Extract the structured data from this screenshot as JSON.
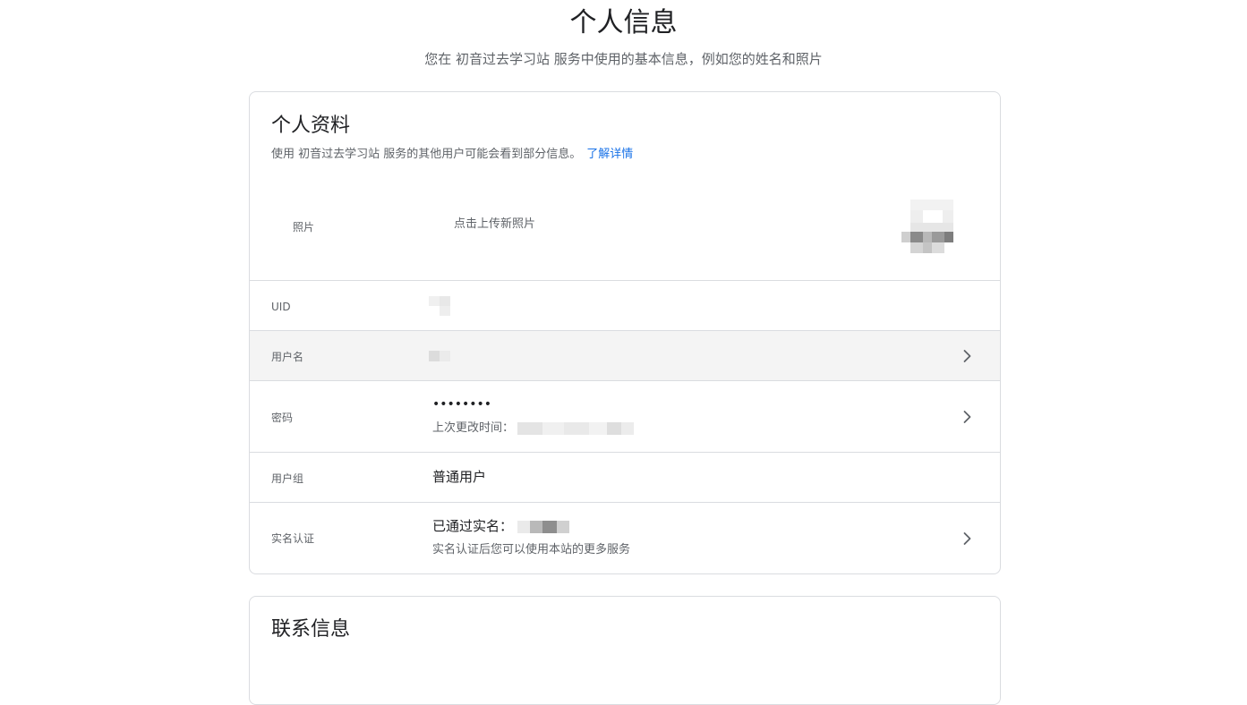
{
  "page": {
    "title": "个人信息",
    "subtitle": "您在 初音过去学习站 服务中使用的基本信息，例如您的姓名和照片"
  },
  "profile": {
    "title": "个人资料",
    "description": "使用 初音过去学习站 服务的其他用户可能会看到部分信息。",
    "learn_more": "了解详情",
    "photo": {
      "label": "照片",
      "hint": "点击上传新照片"
    },
    "uid": {
      "label": "UID"
    },
    "username": {
      "label": "用户名"
    },
    "password": {
      "label": "密码",
      "value": "••••••••",
      "last_changed_label": "上次更改时间："
    },
    "group": {
      "label": "用户组",
      "value": "普通用户"
    },
    "realname": {
      "label": "实名认证",
      "value": "已通过实名：",
      "hint": "实名认证后您可以使用本站的更多服务"
    }
  },
  "contact": {
    "title": "联系信息"
  },
  "icons": {
    "chevron": "chevron-right-icon",
    "avatar": "avatar-pixelated"
  },
  "colors": {
    "link": "#1a73e8",
    "border": "#dadce0",
    "hover_row": "#f4f4f4",
    "secondary_text": "#5f6368"
  }
}
